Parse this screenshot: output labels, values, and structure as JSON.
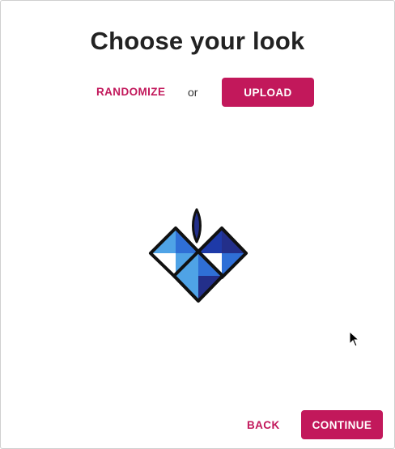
{
  "page": {
    "title": "Choose your look"
  },
  "actions": {
    "randomize_label": "RANDOMIZE",
    "or_label": "or",
    "upload_label": "UPLOAD"
  },
  "avatar": {
    "icon": "geometric-diamond-avatar-icon",
    "colors": {
      "outline": "#111111",
      "blue_light": "#4fa3e6",
      "blue_mid": "#2f6fd6",
      "blue_dark": "#1e3aa8",
      "navy": "#232f8a",
      "white": "#ffffff"
    }
  },
  "footer": {
    "back_label": "BACK",
    "continue_label": "CONTINUE"
  },
  "theme": {
    "accent": "#c2185b",
    "title_color": "#222222",
    "background": "#ffffff"
  }
}
